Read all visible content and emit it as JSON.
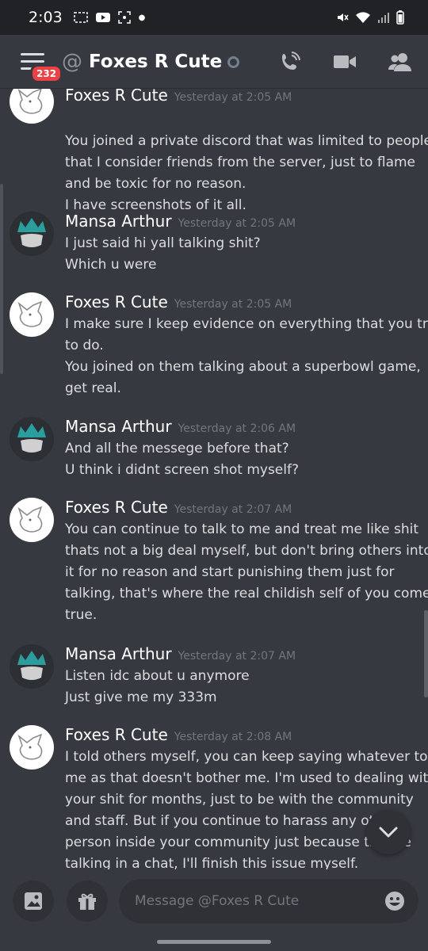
{
  "status_bar": {
    "time": "2:03"
  },
  "header": {
    "notification_badge": "232",
    "at_symbol": "@",
    "dm_name": "Foxes R Cute",
    "icons": [
      "menu-icon",
      "call-icon",
      "video-icon",
      "members-icon"
    ]
  },
  "messages": [
    {
      "author": "Foxes R Cute",
      "timestamp": "Yesterday at 2:05 AM",
      "lines": [
        "You joined a private discord that was limited to people",
        "that I consider friends from the server, just to flame",
        "and be toxic for no reason.",
        "I have screenshots of it all."
      ]
    },
    {
      "author": "Mansa Arthur",
      "timestamp": "Yesterday at 2:05 AM",
      "lines": [
        "I just said hi yall talking shit?",
        "Which u were"
      ]
    },
    {
      "author": "Foxes R Cute",
      "timestamp": "Yesterday at 2:05 AM",
      "lines": [
        "I make sure I keep evidence on everything that you try",
        "to do.",
        "You joined on them talking about a superbowl game,",
        "get real."
      ]
    },
    {
      "author": "Mansa Arthur",
      "timestamp": "Yesterday at 2:06 AM",
      "lines": [
        "And all the messege before that?",
        "U think i didnt screen shot myself?"
      ]
    },
    {
      "author": "Foxes R Cute",
      "timestamp": "Yesterday at 2:07 AM",
      "lines": [
        "You can continue to talk to me and treat me like shit",
        "thats not a big deal myself, but don't bring others into",
        "it for no reason and start punishing them just for",
        "talking, that's where the real childish self of you comes",
        "true."
      ]
    },
    {
      "author": "Mansa Arthur",
      "timestamp": "Yesterday at 2:07 AM",
      "lines": [
        "Listen idc about u anymore",
        "Just give me my 333m"
      ]
    },
    {
      "author": "Foxes R Cute",
      "timestamp": "Yesterday at 2:08 AM",
      "lines": [
        "I told others myself, you can keep saying whatever to",
        "me as that doesn't bother me. I'm used to dealing with",
        "your shit for months, just to be with the community",
        "and staff. But if you continue to harass any other",
        "person inside your community just because they're",
        "talking in a chat, I'll finish this issue myself."
      ]
    }
  ],
  "composer": {
    "placeholder": "Message @Foxes R Cute",
    "icons": [
      "image-icon",
      "gift-icon",
      "emoji-icon"
    ]
  },
  "colors": {
    "background": "#36393f",
    "status_bar": "#202225",
    "text": "#dcddde",
    "timestamp": "#72767d",
    "badge": "#ed4245"
  }
}
